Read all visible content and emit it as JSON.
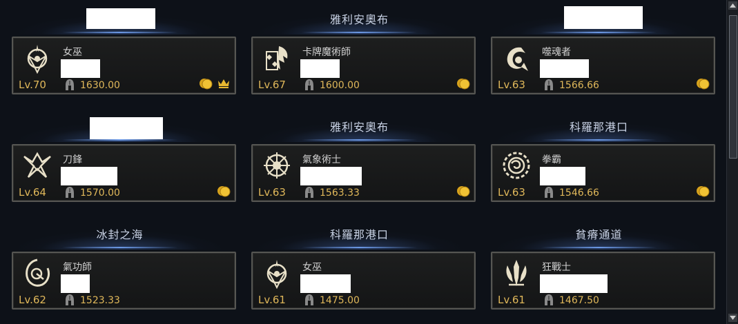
{
  "characters": [
    {
      "server": "",
      "class": "女巫",
      "level": "Lv.70",
      "item_level": "1630.00",
      "icon": "sorceress-emblem-icon",
      "coin": true,
      "crown": true
    },
    {
      "server": "雅利安奧布",
      "class": "卡牌魔術師",
      "level": "Lv.67",
      "item_level": "1600.00",
      "icon": "arcanist-emblem-icon",
      "coin": true,
      "crown": false
    },
    {
      "server": "",
      "class": "噬魂者",
      "level": "Lv.63",
      "item_level": "1566.66",
      "icon": "souleater-emblem-icon",
      "coin": true,
      "crown": false
    },
    {
      "server": "",
      "class": "刀鋒",
      "level": "Lv.64",
      "item_level": "1570.00",
      "icon": "deathblade-emblem-icon",
      "coin": true,
      "crown": false
    },
    {
      "server": "雅利安奧布",
      "class": "氣象術士",
      "level": "Lv.63",
      "item_level": "1563.33",
      "icon": "aeromancer-emblem-icon",
      "coin": true,
      "crown": false
    },
    {
      "server": "科羅那港口",
      "class": "拳霸",
      "level": "Lv.63",
      "item_level": "1546.66",
      "icon": "scrapper-emblem-icon",
      "coin": true,
      "crown": false
    },
    {
      "server": "冰封之海",
      "class": "氣功師",
      "level": "Lv.62",
      "item_level": "1523.33",
      "icon": "soulfist-emblem-icon",
      "coin": false,
      "crown": false
    },
    {
      "server": "科羅那港口",
      "class": "女巫",
      "level": "Lv.61",
      "item_level": "1475.00",
      "icon": "sorceress-emblem-icon",
      "coin": false,
      "crown": false
    },
    {
      "server": "貧瘠通道",
      "class": "狂戰士",
      "level": "Lv.61",
      "item_level": "1467.50",
      "icon": "berserker-emblem-icon",
      "coin": false,
      "crown": false
    }
  ],
  "colors": {
    "gold": "#e0b85a",
    "border": "#565652",
    "header_glow": "#78aaff"
  }
}
